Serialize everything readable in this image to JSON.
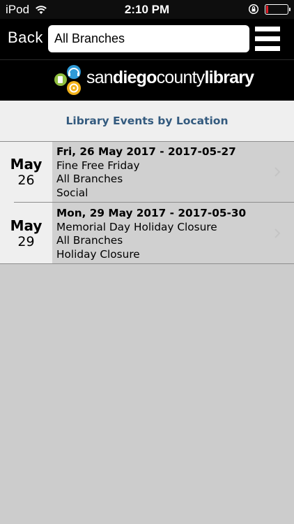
{
  "status_bar": {
    "carrier": "iPod",
    "time": "2:10 PM",
    "battery_level": 0.1,
    "battery_color": "#e0202a"
  },
  "nav": {
    "back_label": "Back",
    "branch_value": "All Branches",
    "menu_icon": "hamburger-menu-icon"
  },
  "logo": {
    "text_light_1": "san",
    "text_bold_1": "diego",
    "text_light_2": "county",
    "text_bold_2": "library"
  },
  "section": {
    "title": "Library Events by Location",
    "title_color": "#335a7e"
  },
  "events": [
    {
      "month": "May",
      "day": "26",
      "date_line": "Fri, 26 May 2017 - 2017-05-27",
      "title": "Fine Free Friday",
      "branch": "All Branches",
      "category": "Social"
    },
    {
      "month": "May",
      "day": "29",
      "date_line": "Mon, 29 May 2017 - 2017-05-30",
      "title": "Memorial Day Holiday Closure",
      "branch": "All Branches",
      "category": "Holiday Closure"
    }
  ]
}
